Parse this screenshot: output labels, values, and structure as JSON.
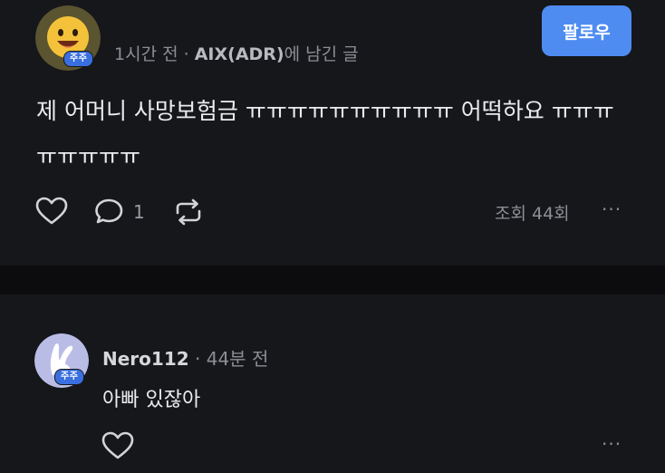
{
  "post": {
    "time": "1시간 전",
    "separator": "·",
    "board": "AIX(ADR)",
    "board_suffix": "에 남긴 글",
    "badge": "주주",
    "follow_label": "팔로우",
    "text": "제 어머니 사망보험금 ㅠㅠㅠㅠㅠㅠㅠㅠㅠㅠ 어떡하요 ㅠㅠㅠㅠㅠㅠㅠㅠ",
    "comment_count": "1",
    "views": "조회 44회",
    "more": "···"
  },
  "comment": {
    "author": "Nero112",
    "separator": "·",
    "time": "44분 전",
    "badge": "주주",
    "text": "아빠 있잖아",
    "more": "···"
  },
  "colors": {
    "accent": "#4e8cf1",
    "badge": "#3a6fe0",
    "background": "#16171b",
    "divider": "#0c0c0e"
  },
  "icons": [
    "heart-icon",
    "comment-icon",
    "repost-icon",
    "more-icon"
  ]
}
